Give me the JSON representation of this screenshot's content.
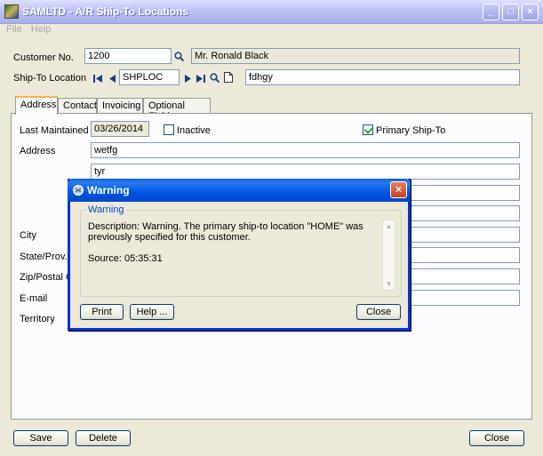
{
  "window": {
    "title": "SAMLTD - A/R Ship-To Locations"
  },
  "titlebar_buttons": {
    "minimize": "_",
    "maximize": "□",
    "close": "×"
  },
  "menu": [
    {
      "label": "File"
    },
    {
      "label": "Help"
    }
  ],
  "header": {
    "customer_label": "Customer No.",
    "customer_no": "1200",
    "customer_name": "Mr. Ronald Black",
    "shipto_label": "Ship-To Location",
    "shipto_code": "SHPLOC",
    "shipto_desc": "fdhgy"
  },
  "tabs": [
    {
      "label": "Address"
    },
    {
      "label": "Contact"
    },
    {
      "label": "Invoicing"
    },
    {
      "label": "Optional Fields"
    }
  ],
  "address_tab": {
    "last_maintained_label": "Last Maintained",
    "last_maintained": "03/26/2014",
    "inactive_label": "Inactive",
    "inactive_checked": false,
    "primary_label": "Primary Ship-To",
    "primary_checked": true,
    "address_label": "Address",
    "address_lines": [
      "wetfg",
      "tyr",
      "",
      ""
    ],
    "city_label": "City",
    "state_label": "State/Prov.",
    "zip_label": "Zip/Postal Co",
    "email_label": "E-mail",
    "territory_label": "Territory"
  },
  "footer": {
    "save": "Save",
    "delete": "Delete",
    "close": "Close"
  },
  "dialog": {
    "title": "Warning",
    "group_label": "Warning",
    "description": "Description: Warning. The primary ship-to location \"HOME\" was previously specified for this customer.",
    "source": "Source:  05:35:31",
    "close_x": "×",
    "print": "Print",
    "help": "Help ...",
    "close": "Close"
  },
  "colors": {
    "dialog_title": "#0054e3",
    "tab_highlight": "#f7b44a",
    "legend_text": "#0046d5"
  }
}
